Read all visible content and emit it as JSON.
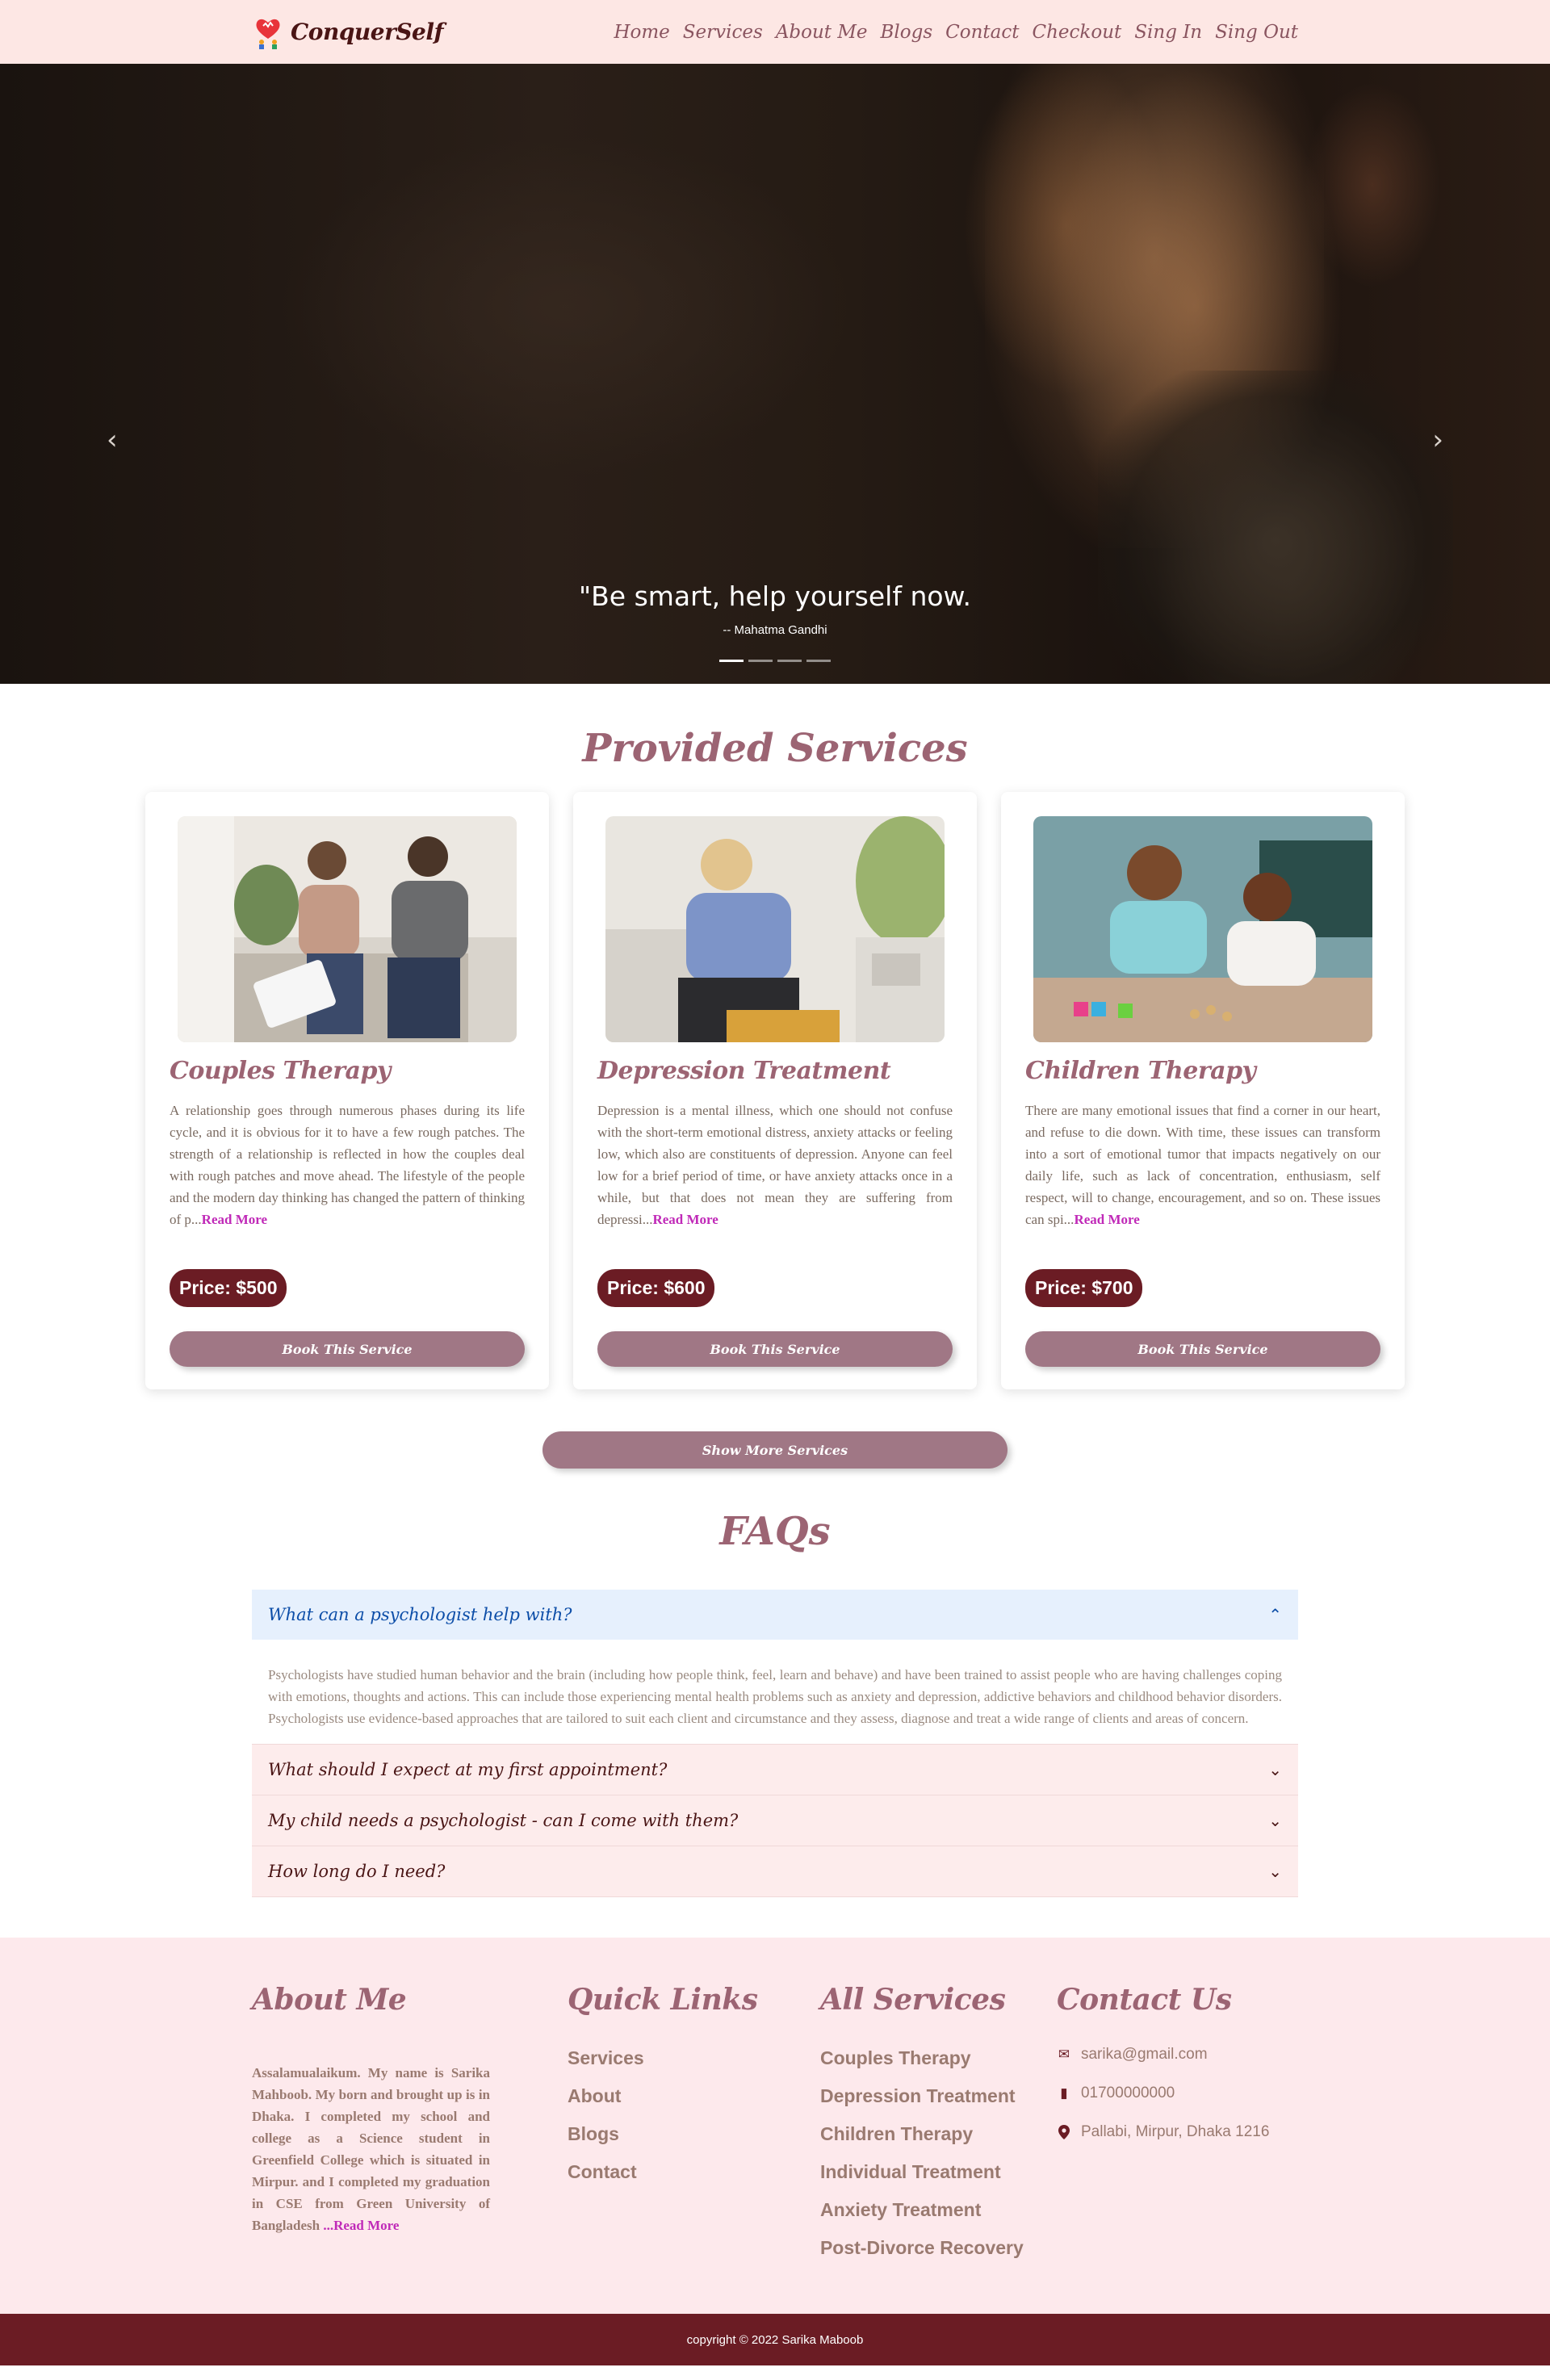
{
  "brand": {
    "name": "ConquerSelf"
  },
  "nav": [
    {
      "label": "Home"
    },
    {
      "label": "Services"
    },
    {
      "label": "About Me"
    },
    {
      "label": "Blogs"
    },
    {
      "label": "Contact"
    },
    {
      "label": "Checkout"
    },
    {
      "label": "Sing In"
    },
    {
      "label": "Sing Out"
    }
  ],
  "hero": {
    "quote": "\"Be smart, help yourself now.",
    "author": "-- Mahatma Gandhi",
    "prev_icon": "‹",
    "next_icon": "›",
    "slides": 4,
    "active_slide": 1
  },
  "services": {
    "title": "Provided Services",
    "cards": [
      {
        "title": "Couples Therapy",
        "text": "A relationship goes through numerous phases during its life cycle, and it is obvious for it to have a few rough patches. The strength of a relationship is reflected in how the couples deal with rough patches and move ahead. The lifestyle of the people and the modern day thinking has changed the pattern of thinking of p...",
        "read_more": "Read More",
        "price": "Price: $500",
        "button": "Book This Service"
      },
      {
        "title": "Depression Treatment",
        "text": "Depression is a mental illness, which one should not confuse with the short-term emotional distress, anxiety attacks or feeling low, which also are constituents of depression. Anyone can feel low for a brief period of time, or have anxiety attacks once in a while, but that does not mean they are suffering from depressi...",
        "read_more": "Read More",
        "price": "Price: $600",
        "button": "Book This Service"
      },
      {
        "title": "Children Therapy",
        "text": "There are many emotional issues that find a corner in our heart, and refuse to die down. With time, these issues can transform into a sort of emotional tumor that impacts negatively on our daily life, such as lack of concentration, enthusiasm, self respect, will to change, encouragement, and so on. These issues can spi...",
        "read_more": "Read More",
        "price": "Price: $700",
        "button": "Book This Service"
      }
    ],
    "show_more": "Show More Services"
  },
  "faq": {
    "title": "FAQs",
    "items": [
      {
        "question": "What can a psychologist help with?",
        "answer": "Psychologists have studied human behavior and the brain (including how people think, feel, learn and behave) and have been trained to assist people who are having challenges coping with emotions, thoughts and actions. This can include those experiencing mental health problems such as anxiety and depression, addictive behaviors and childhood behavior disorders. Psychologists use evidence-based approaches that are tailored to suit each client and circumstance and they assess, diagnose and treat a wide range of clients and areas of concern.",
        "open": true,
        "chevron": "⌃"
      },
      {
        "question": "What should I expect at my first appointment?",
        "open": false,
        "chevron": "⌄"
      },
      {
        "question": "My child needs a psychologist - can I come with them?",
        "open": false,
        "chevron": "⌄"
      },
      {
        "question": "How long do I need?",
        "open": false,
        "chevron": "⌄"
      }
    ]
  },
  "footer": {
    "about": {
      "title": "About Me",
      "text": "Assalamualaikum. My name is Sarika Mahboob. My born and brought up is in Dhaka. I completed my school and college as a Science student in Greenfield College which is situated in Mirpur. and I completed my graduation in CSE from Green University of Bangladesh ",
      "read_more": "...Read More"
    },
    "quick_links": {
      "title": "Quick Links",
      "items": [
        "Services",
        "About",
        "Blogs",
        "Contact"
      ]
    },
    "all_services": {
      "title": "All Services",
      "items": [
        "Couples Therapy",
        "Depression Treatment",
        "Children Therapy",
        "Individual Treatment",
        "Anxiety Treatment",
        "Post-Divorce Recovery"
      ]
    },
    "contact": {
      "title": "Contact Us",
      "email": "sarika@gmail.com",
      "phone": "01700000000",
      "address": "Pallabi, Mirpur, Dhaka 1216",
      "email_icon": "✉",
      "phone_icon": "▮",
      "address_icon": "⬤"
    },
    "copyright": "copyright © 2022 Sarika Maboob"
  },
  "colors": {
    "nav_bg": "#fde7e4",
    "accent": "#9c6473",
    "dark_maroon": "#6b1c24",
    "button": "#a07785",
    "read_more": "#c02ab8",
    "faq_open_bg": "#e6f0fd",
    "footer_bg": "#fde9ec"
  }
}
